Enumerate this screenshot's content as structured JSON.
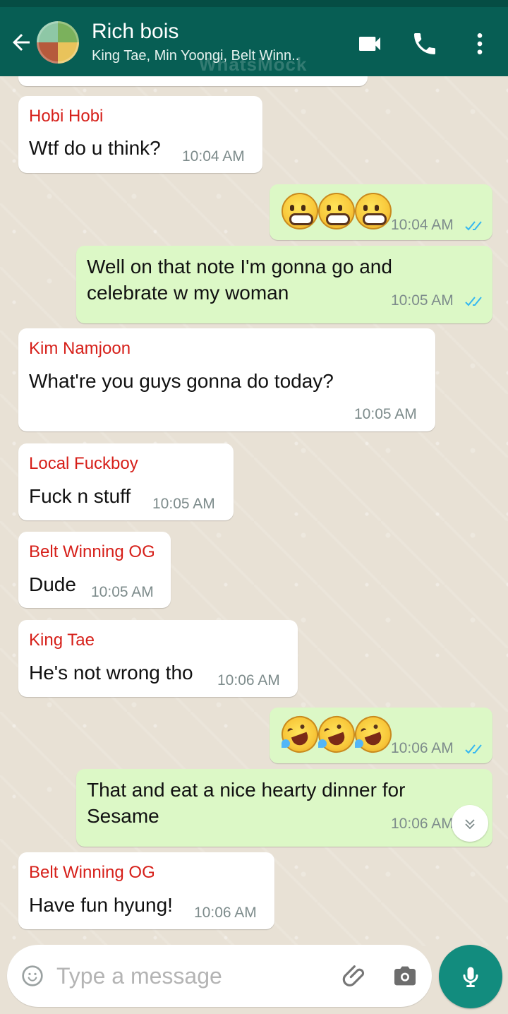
{
  "header": {
    "title": "Rich bois",
    "subtitle": "King Tae, Min Yoongi, Belt Winn..",
    "watermark": "WhatsMock"
  },
  "messages": [
    {
      "type": "in",
      "sender": "Hobi Hobi",
      "text": "Wtf do u think?",
      "time": "10:04 AM"
    },
    {
      "type": "out",
      "emojis": [
        "grinning-face",
        "grinning-face",
        "grinning-face"
      ],
      "time": "10:04 AM"
    },
    {
      "type": "out",
      "text": "Well on that note I'm gonna go and celebrate w my woman",
      "time": "10:05 AM"
    },
    {
      "type": "in",
      "sender": "Kim Namjoon",
      "text": "What're you guys gonna do today?",
      "time": "10:05 AM"
    },
    {
      "type": "in",
      "sender": "Local Fuckboy",
      "text": "Fuck n stuff",
      "time": "10:05 AM"
    },
    {
      "type": "in",
      "sender": "Belt Winning OG",
      "text": "Dude",
      "time": "10:05 AM"
    },
    {
      "type": "in",
      "sender": "King Tae",
      "text": "He's not wrong tho",
      "time": "10:06 AM"
    },
    {
      "type": "out",
      "emojis": [
        "rolling-on-floor-laughing",
        "rolling-on-floor-laughing",
        "rolling-on-floor-laughing"
      ],
      "time": "10:06 AM"
    },
    {
      "type": "out",
      "text": "That and eat a nice hearty dinner for Sesame",
      "time": "10:06 AM"
    },
    {
      "type": "in",
      "sender": "Belt Winning OG",
      "text": "Have fun hyung!",
      "time": "10:06 AM"
    }
  ],
  "input": {
    "placeholder": "Type a message"
  },
  "colors": {
    "header": "#075e54",
    "sender": "#d61f19",
    "outgoing": "#dcf8c6",
    "incoming": "#ffffff",
    "mic": "#128c7e",
    "read_ticks": "#34b7f1"
  },
  "icons": {
    "back": "arrow-left-icon",
    "video": "video-camera-icon",
    "call": "phone-icon",
    "more": "more-vertical-icon",
    "emoji": "smile-icon",
    "attach": "paperclip-icon",
    "camera": "camera-icon",
    "mic": "microphone-icon",
    "scroll": "double-chevron-down-icon"
  }
}
